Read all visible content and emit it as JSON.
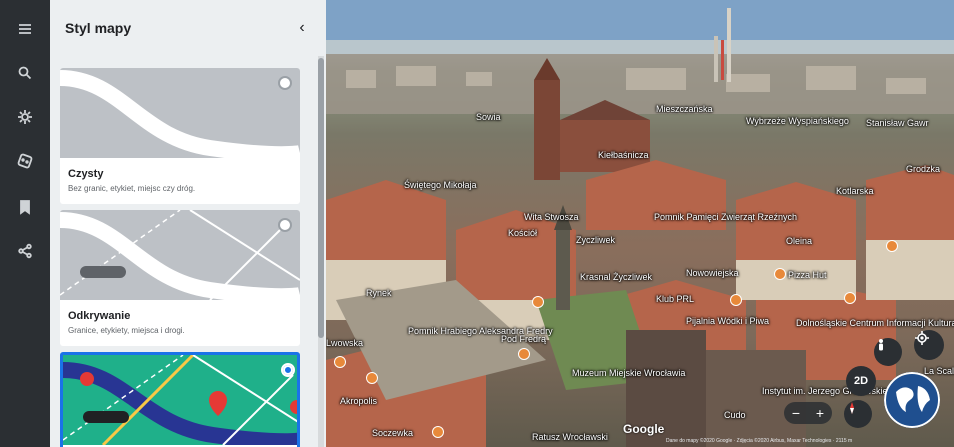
{
  "rail": {
    "icons": [
      "menu-icon",
      "search-icon",
      "voyager-icon",
      "dice-icon",
      "bookmark-icon",
      "share-icon"
    ]
  },
  "panel": {
    "title": "Styl mapy",
    "collapse_glyph": "‹",
    "styles": [
      {
        "name": "Czysty",
        "description": "Bez granic, etykiet, miejsc czy dróg.",
        "selected": false
      },
      {
        "name": "Odkrywanie",
        "description": "Granice, etykiety, miejsca i drogi.",
        "selected": false
      },
      {
        "name": "",
        "description": "",
        "selected": true
      }
    ]
  },
  "map": {
    "labels": [
      "Sowia",
      "Mieszczańska",
      "Wybrzeże Wyspiańskiego",
      "Stanisław Gawr",
      "Grodzka",
      "Świętego Mikołaja",
      "Kiełbaśnicza",
      "Kotlarska",
      "Zyczliwek",
      "Wita Stwosza",
      "Pomnik Pamięci Zwierząt Rzeźnych",
      "Oleina",
      "Kościół",
      "Nowowiejska",
      "Pizza Hut",
      "Rynek",
      "Krasnal Życzliwek",
      "Klub PRL",
      "Pijalnia Wódki i Piwa",
      "Dolnośląskie Centrum Informacji Kulturalnej",
      "Lwowska",
      "Pomnik Hrabiego Aleksandra Fredry",
      "Pod Fredrą",
      "Muzeum Miejskie Wrocławia",
      "Instytut im. Jerzego Grotowskiego",
      "Akropolis",
      "Soczewka",
      "Ratusz Wrocławski",
      "La Scala",
      "Cudo"
    ],
    "view_mode": "2D",
    "zoom_out": "−",
    "zoom_in": "+",
    "google_logo": "Google",
    "attribution": "Dane do mapy ©2020 Google · Zdjęcia ©2020 Airbus, Maxar Technologies · 2115 m"
  },
  "colors": {
    "rail_bg": "#2b2f33",
    "panel_bg": "#eceff1",
    "accent": "#1a73e8",
    "pin": "#e8893a",
    "explorer_green": "#1fb08a",
    "explorer_navy": "#283593",
    "explorer_red": "#e53935",
    "explorer_yellow": "#f9c846"
  }
}
